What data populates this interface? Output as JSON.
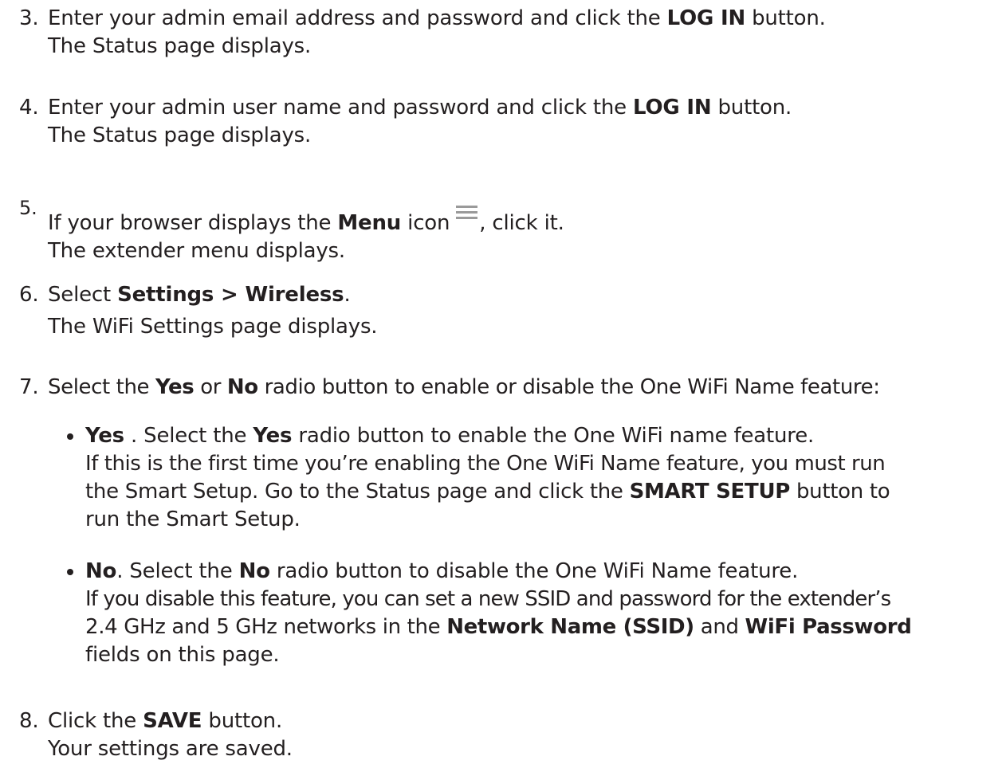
{
  "steps": [
    {
      "number": "3.",
      "lines": [
        [
          "Enter your admin email address and password and click the ",
          "LOG IN",
          " button."
        ],
        [
          "The Status page displays."
        ]
      ]
    },
    {
      "number": "4.",
      "lines": [
        [
          "Enter your admin user name and password and click the ",
          "LOG IN",
          " button."
        ],
        [
          "The Status page displays."
        ]
      ]
    },
    {
      "number": "5.",
      "line1": {
        "a": "If your browser displays the ",
        "bold": "Menu",
        "b": " icon",
        "icon": "menu-icon",
        "c": ", click it."
      },
      "line2": "The extender menu displays."
    },
    {
      "number": "6.",
      "line1": {
        "a": "Select ",
        "bold": "Settings > Wireless",
        "b": "."
      },
      "line2": "The WiFi Settings page displays."
    },
    {
      "number": "7.",
      "line1": {
        "a": "Select the ",
        "bold1": "Yes",
        "b": " or ",
        "bold2": "No",
        "c": " radio button to enable or disable the One WiFi Name feature:"
      }
    },
    {
      "number": "8.",
      "line1": {
        "a": "Click the ",
        "bold": "SAVE",
        "b": " button."
      },
      "line2": "Your settings are saved."
    }
  ],
  "bullets": [
    {
      "line1": {
        "bold1": "Yes",
        "a": " . Select the ",
        "bold2": "Yes",
        "b": " radio button to enable the One WiFi name feature."
      },
      "line2": "If this is the first time you’re enabling the One WiFi Name feature, you must run",
      "line3": {
        "a": "the Smart Setup. Go to the Status page and click the ",
        "bold": "SMART SETUP",
        "b": " button to"
      },
      "line4": "run the Smart Setup."
    },
    {
      "line1": {
        "bold1": "No",
        "a": ". Select the ",
        "bold2": "No",
        "b": " radio button to disable the One WiFi Name feature."
      },
      "line2": "If you disable this feature, you can set a new SSID and password for the extender’s",
      "line3": {
        "a": "2.4 GHz and 5 GHz networks in the ",
        "bold1": "Network Name (SSID)",
        "b": " and ",
        "bold2": "WiFi Password"
      },
      "line4": "fields on this page."
    }
  ]
}
